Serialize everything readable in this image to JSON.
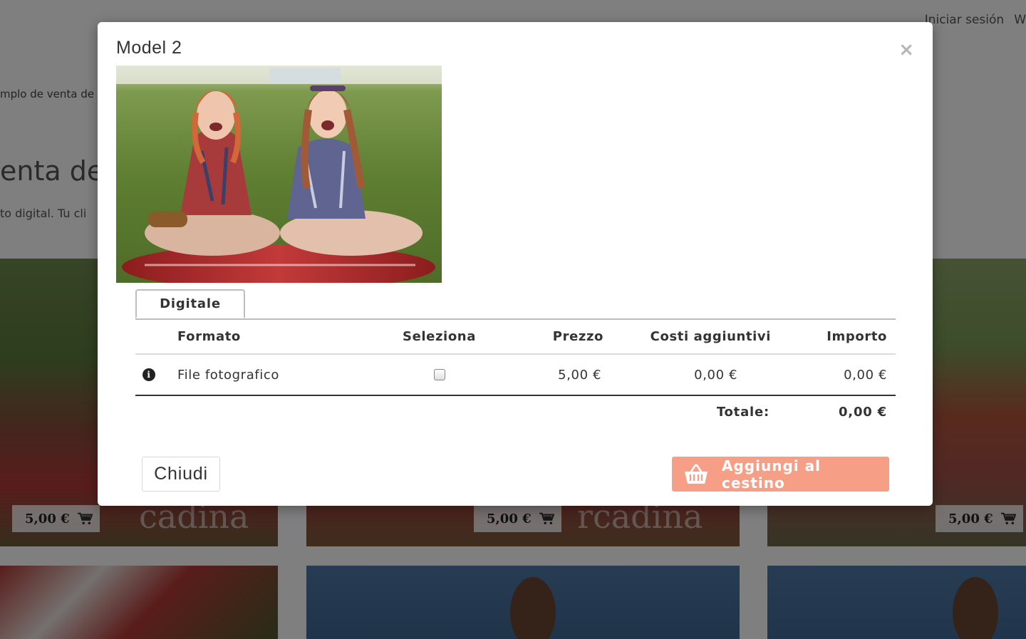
{
  "background": {
    "nav": {
      "login": "Iniciar sesión",
      "extra": "W"
    },
    "breadcrumb": "mplo de venta de f",
    "heading": "enta de f",
    "description": "to digital. Tu cli",
    "watermark": "cadina",
    "watermark2": "rcadina",
    "price_tags": [
      "5,00 €",
      "5,00 €",
      "5,00 €"
    ],
    "icons": {
      "cart": "shopping-cart-icon"
    }
  },
  "modal": {
    "title": "Model 2",
    "close_glyph": "×",
    "tab_label": "Digitale",
    "table": {
      "headers": {
        "format": "Formato",
        "select": "Seleziona",
        "price": "Prezzo",
        "extra": "Costi aggiuntivi",
        "amount": "Importo"
      },
      "rows": [
        {
          "info_glyph": "i",
          "format": "File fotografico",
          "selected": false,
          "price": "5,00 €",
          "extra": "0,00 €",
          "amount": "0,00 €"
        }
      ],
      "total_label": "Totale:",
      "total_value": "0,00 €"
    },
    "buttons": {
      "close": "Chiudi",
      "add_to_cart": "Aggiungi al cestino"
    },
    "colors": {
      "accent": "#f79f86",
      "overlay": "rgba(0,0,0,0.5)"
    },
    "icons": {
      "info": "info-icon",
      "basket": "basket-icon",
      "close": "close-icon"
    }
  }
}
